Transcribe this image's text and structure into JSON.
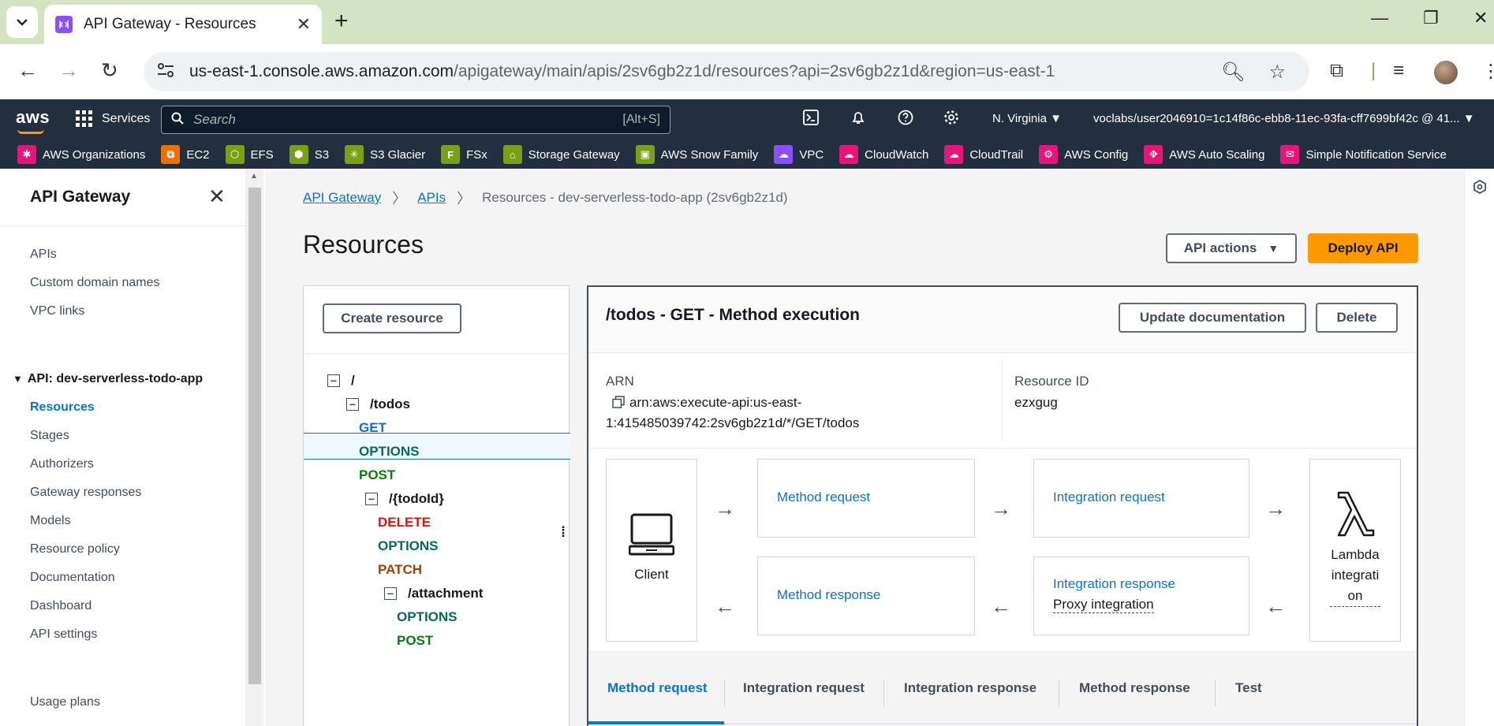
{
  "browser": {
    "tab_title": "API Gateway - Resources",
    "url_domain": "us-east-1.console.aws.amazon.com",
    "url_path": "/apigateway/main/apis/2sv6gb2z1d/resources?api=2sv6gb2z1d&region=us-east-1"
  },
  "awsnav": {
    "services_label": "Services",
    "search_placeholder": "Search",
    "search_shortcut": "[Alt+S]",
    "region": "N. Virginia ▼",
    "account": "voclabs/user2046910=1c14f86c-ebb8-11ec-93fa-cff7699bf42c @ 41... ▼"
  },
  "favorites": [
    {
      "label": "AWS Organizations",
      "color": "#e7157b"
    },
    {
      "label": "EC2",
      "color": "#ed7100"
    },
    {
      "label": "EFS",
      "color": "#7aa116"
    },
    {
      "label": "S3",
      "color": "#7aa116"
    },
    {
      "label": "S3 Glacier",
      "color": "#7aa116"
    },
    {
      "label": "FSx",
      "color": "#7aa116"
    },
    {
      "label": "Storage Gateway",
      "color": "#7aa116"
    },
    {
      "label": "AWS Snow Family",
      "color": "#7aa116"
    },
    {
      "label": "VPC",
      "color": "#8c4fff"
    },
    {
      "label": "CloudWatch",
      "color": "#e7157b"
    },
    {
      "label": "CloudTrail",
      "color": "#e7157b"
    },
    {
      "label": "AWS Config",
      "color": "#e7157b"
    },
    {
      "label": "AWS Auto Scaling",
      "color": "#e7157b"
    },
    {
      "label": "Simple Notification Service",
      "color": "#e7157b"
    }
  ],
  "sidebar": {
    "title": "API Gateway",
    "items": [
      "APIs",
      "Custom domain names",
      "VPC links"
    ],
    "api_group": "API: dev-serverless-todo-app",
    "api_items": [
      "Resources",
      "Stages",
      "Authorizers",
      "Gateway responses",
      "Models",
      "Resource policy",
      "Documentation",
      "Dashboard",
      "API settings"
    ],
    "usage_plans": "Usage plans"
  },
  "breadcrumb": {
    "root": "API Gateway",
    "apis": "APIs",
    "current": "Resources - dev-serverless-todo-app (2sv6gb2z1d)"
  },
  "page": {
    "title": "Resources",
    "api_actions": "API actions",
    "deploy": "Deploy API"
  },
  "resources": {
    "create_button": "Create resource",
    "tree": [
      {
        "label": "/",
        "kind": "path"
      },
      {
        "label": "/todos",
        "kind": "path"
      },
      {
        "label": "GET",
        "kind": "get"
      },
      {
        "label": "OPTIONS",
        "kind": "options"
      },
      {
        "label": "POST",
        "kind": "post"
      },
      {
        "label": "/{todoId}",
        "kind": "path"
      },
      {
        "label": "DELETE",
        "kind": "delete"
      },
      {
        "label": "OPTIONS",
        "kind": "options"
      },
      {
        "label": "PATCH",
        "kind": "patch"
      },
      {
        "label": "/attachment",
        "kind": "path"
      },
      {
        "label": "OPTIONS",
        "kind": "options"
      },
      {
        "label": "POST",
        "kind": "post"
      }
    ]
  },
  "execution": {
    "title": "/todos - GET - Method execution",
    "update_doc": "Update documentation",
    "delete": "Delete",
    "arn_label": "ARN",
    "arn_line1": "arn:aws:execute-api:us-east-",
    "arn_line2": "1:415485039742:2sv6gb2z1d/*/GET/todos",
    "resource_id_label": "Resource ID",
    "resource_id": "ezxgug",
    "client": "Client",
    "method_request": "Method request",
    "integration_request": "Integration request",
    "method_response": "Method response",
    "integration_response": "Integration response",
    "proxy_integration": "Proxy integration",
    "lambda_l1": "Lambda",
    "lambda_l2": "integrati",
    "lambda_l3": "on"
  },
  "tabs": [
    "Method request",
    "Integration request",
    "Integration response",
    "Method response",
    "Test"
  ]
}
